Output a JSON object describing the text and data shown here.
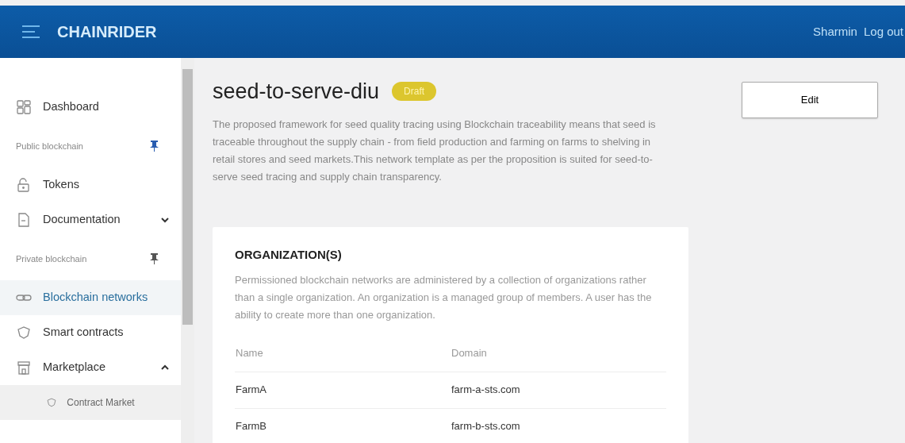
{
  "navbar": {
    "brand": "CHAINRIDER",
    "user": "Sharmin",
    "logout": "Log out"
  },
  "sidebar": {
    "items": [
      {
        "kind": "item",
        "label": "Dashboard",
        "selected": false
      },
      {
        "kind": "section",
        "label": "Public blockchain"
      },
      {
        "kind": "item",
        "label": "Tokens",
        "selected": false
      },
      {
        "kind": "item",
        "label": "Documentation",
        "selected": false,
        "expanded": false
      },
      {
        "kind": "section",
        "label": "Private blockchain"
      },
      {
        "kind": "item",
        "label": "Blockchain networks",
        "selected": true
      },
      {
        "kind": "item",
        "label": "Smart contracts",
        "selected": false
      },
      {
        "kind": "item",
        "label": "Marketplace",
        "selected": false,
        "expanded": true
      },
      {
        "kind": "subitem",
        "label": "Contract Market",
        "selected": false
      }
    ]
  },
  "page": {
    "title": "seed-to-serve-diu",
    "status": "Draft",
    "description": "The proposed framework for seed quality tracing using Blockchain traceability means that seed is traceable throughout the supply chain - from field production and farming on farms to shelving in retail stores and seed markets.This network template as per the proposition is suited for seed-to-serve seed tracing and supply chain transparency.",
    "edit_button": "Edit"
  },
  "organizations": {
    "heading": "ORGANIZATION(S)",
    "description": "Permissioned blockchain networks are administered by a collection of organizations rather than a single organization. An organization is a managed group of members. A user has the ability to create more than one organization.",
    "columns": [
      "Name",
      "Domain"
    ],
    "rows": [
      [
        "FarmA",
        "farm-a-sts.com"
      ],
      [
        "FarmB",
        "farm-b-sts.com"
      ]
    ]
  }
}
